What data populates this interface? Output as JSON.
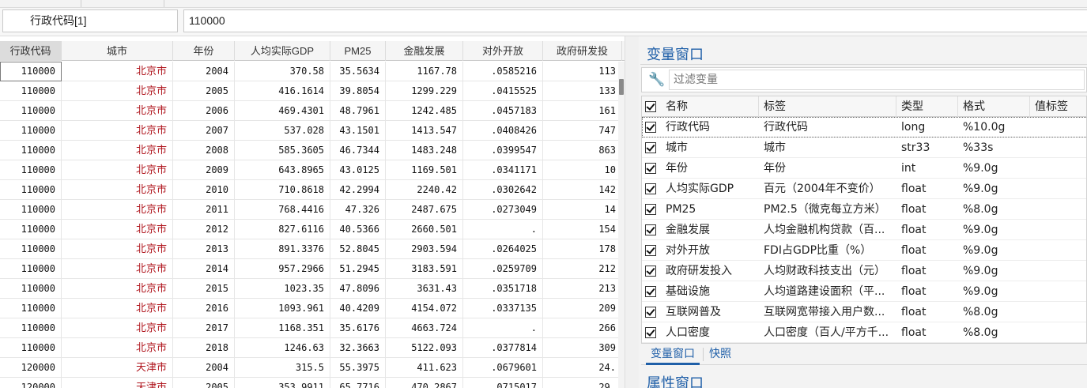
{
  "formula_bar": {
    "cell_name": "行政代码[1]",
    "cell_value": "110000"
  },
  "data_grid": {
    "columns": [
      "行政代码",
      "城市",
      "年份",
      "人均实际GDP",
      "PM25",
      "金融发展",
      "对外开放",
      "政府研发投"
    ],
    "rows": [
      [
        "110000",
        "北京市",
        "2004",
        "370.58",
        "35.5634",
        "1167.78",
        ".0585216",
        "113"
      ],
      [
        "110000",
        "北京市",
        "2005",
        "416.1614",
        "39.8054",
        "1299.229",
        ".0415525",
        "133"
      ],
      [
        "110000",
        "北京市",
        "2006",
        "469.4301",
        "48.7961",
        "1242.485",
        ".0457183",
        "161"
      ],
      [
        "110000",
        "北京市",
        "2007",
        "537.028",
        "43.1501",
        "1413.547",
        ".0408426",
        "747"
      ],
      [
        "110000",
        "北京市",
        "2008",
        "585.3605",
        "46.7344",
        "1483.248",
        ".0399547",
        "863"
      ],
      [
        "110000",
        "北京市",
        "2009",
        "643.8965",
        "43.0125",
        "1169.501",
        ".0341171",
        "10"
      ],
      [
        "110000",
        "北京市",
        "2010",
        "710.8618",
        "42.2994",
        "2240.42",
        ".0302642",
        "142"
      ],
      [
        "110000",
        "北京市",
        "2011",
        "768.4416",
        "47.326",
        "2487.675",
        ".0273049",
        "14"
      ],
      [
        "110000",
        "北京市",
        "2012",
        "827.6116",
        "40.5366",
        "2660.501",
        ".",
        "154"
      ],
      [
        "110000",
        "北京市",
        "2013",
        "891.3376",
        "52.8045",
        "2903.594",
        ".0264025",
        "178"
      ],
      [
        "110000",
        "北京市",
        "2014",
        "957.2966",
        "51.2945",
        "3183.591",
        ".0259709",
        "212"
      ],
      [
        "110000",
        "北京市",
        "2015",
        "1023.35",
        "47.8096",
        "3631.43",
        ".0351718",
        "213"
      ],
      [
        "110000",
        "北京市",
        "2016",
        "1093.961",
        "40.4209",
        "4154.072",
        ".0337135",
        "209"
      ],
      [
        "110000",
        "北京市",
        "2017",
        "1168.351",
        "35.6176",
        "4663.724",
        ".",
        "266"
      ],
      [
        "110000",
        "北京市",
        "2018",
        "1246.63",
        "32.3663",
        "5122.093",
        ".0377814",
        "309"
      ],
      [
        "120000",
        "天津市",
        "2004",
        "315.5",
        "55.3975",
        "411.623",
        ".0679601",
        "24."
      ],
      [
        "120000",
        "天津市",
        "2005",
        "353.9911",
        "65.7716",
        "470.2867",
        ".0715017",
        "29."
      ]
    ]
  },
  "variables_panel": {
    "title": "变量窗口",
    "filter_placeholder": "过滤变量",
    "columns": [
      "名称",
      "标签",
      "类型",
      "格式",
      "值标签"
    ],
    "variables": [
      {
        "name": "行政代码",
        "label": "行政代码",
        "type": "long",
        "format": "%10.0g",
        "value_label": ""
      },
      {
        "name": "城市",
        "label": "城市",
        "type": "str33",
        "format": "%33s",
        "value_label": ""
      },
      {
        "name": "年份",
        "label": "年份",
        "type": "int",
        "format": "%9.0g",
        "value_label": ""
      },
      {
        "name": "人均实际GDP",
        "label": "百元（2004年不变价）",
        "type": "float",
        "format": "%9.0g",
        "value_label": ""
      },
      {
        "name": "PM25",
        "label": "PM2.5（微克每立方米）",
        "type": "float",
        "format": "%8.0g",
        "value_label": ""
      },
      {
        "name": "金融发展",
        "label": "人均金融机构贷款（百...",
        "type": "float",
        "format": "%9.0g",
        "value_label": ""
      },
      {
        "name": "对外开放",
        "label": "FDI占GDP比重（%）",
        "type": "float",
        "format": "%9.0g",
        "value_label": ""
      },
      {
        "name": "政府研发投入",
        "label": "人均财政科技支出（元）",
        "type": "float",
        "format": "%9.0g",
        "value_label": ""
      },
      {
        "name": "基础设施",
        "label": "人均道路建设面积（平...",
        "type": "float",
        "format": "%9.0g",
        "value_label": ""
      },
      {
        "name": "互联网普及",
        "label": "互联网宽带接入用户数...",
        "type": "float",
        "format": "%8.0g",
        "value_label": ""
      },
      {
        "name": "人口密度",
        "label": "人口密度（百人/平方千...",
        "type": "float",
        "format": "%8.0g",
        "value_label": ""
      }
    ],
    "tabs": [
      "变量窗口",
      "快照"
    ]
  },
  "properties_panel": {
    "title": "属性窗口"
  },
  "colors": {
    "accent": "#1f5fa8",
    "city_text": "#b0171f"
  },
  "icons": {
    "filter": "wrench-icon",
    "checkbox": "checkbox-checked-icon"
  }
}
